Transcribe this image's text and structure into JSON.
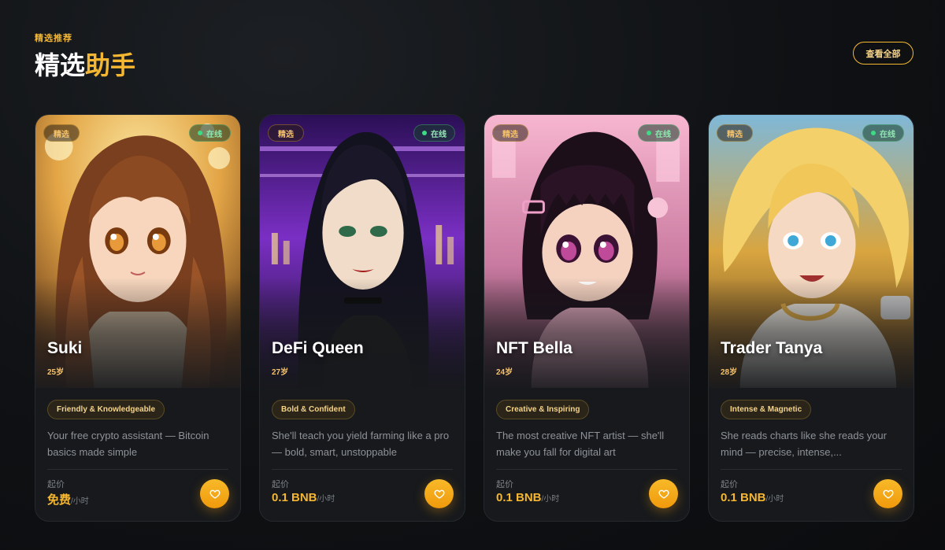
{
  "section": {
    "eyebrow": "精选推荐",
    "title_main": "精选",
    "title_highlight": "助手",
    "view_all": "查看全部"
  },
  "cards": [
    {
      "featured_label": "精选",
      "online_label": "在线",
      "name": "Suki",
      "age": "25岁",
      "tag": "Friendly & Knowledgeable",
      "description": "Your free crypto assistant — Bitcoin basics made simple",
      "price_label": "起价",
      "price": "免费",
      "price_unit": "/小时"
    },
    {
      "featured_label": "精选",
      "online_label": "在线",
      "name": "DeFi Queen",
      "age": "27岁",
      "tag": "Bold & Confident",
      "description": "She'll teach you yield farming like a pro — bold, smart, unstoppable",
      "price_label": "起价",
      "price": "0.1 BNB",
      "price_unit": "/小时"
    },
    {
      "featured_label": "精选",
      "online_label": "在线",
      "name": "NFT Bella",
      "age": "24岁",
      "tag": "Creative & Inspiring",
      "description": "The most creative NFT artist — she'll make you fall for digital art",
      "price_label": "起价",
      "price": "0.1 BNB",
      "price_unit": "/小时"
    },
    {
      "featured_label": "精选",
      "online_label": "在线",
      "name": "Trader Tanya",
      "age": "28岁",
      "tag": "Intense & Magnetic",
      "description": "She reads charts like she reads your mind — precise, intense,...",
      "price_label": "起价",
      "price": "0.1 BNB",
      "price_unit": "/小时"
    }
  ],
  "icons": {
    "favorite": "heart-icon",
    "online": "status-dot-icon"
  },
  "colors": {
    "accent": "#f5b731",
    "background": "#0f1114",
    "card": "#17191c",
    "online": "#3ddc84"
  }
}
